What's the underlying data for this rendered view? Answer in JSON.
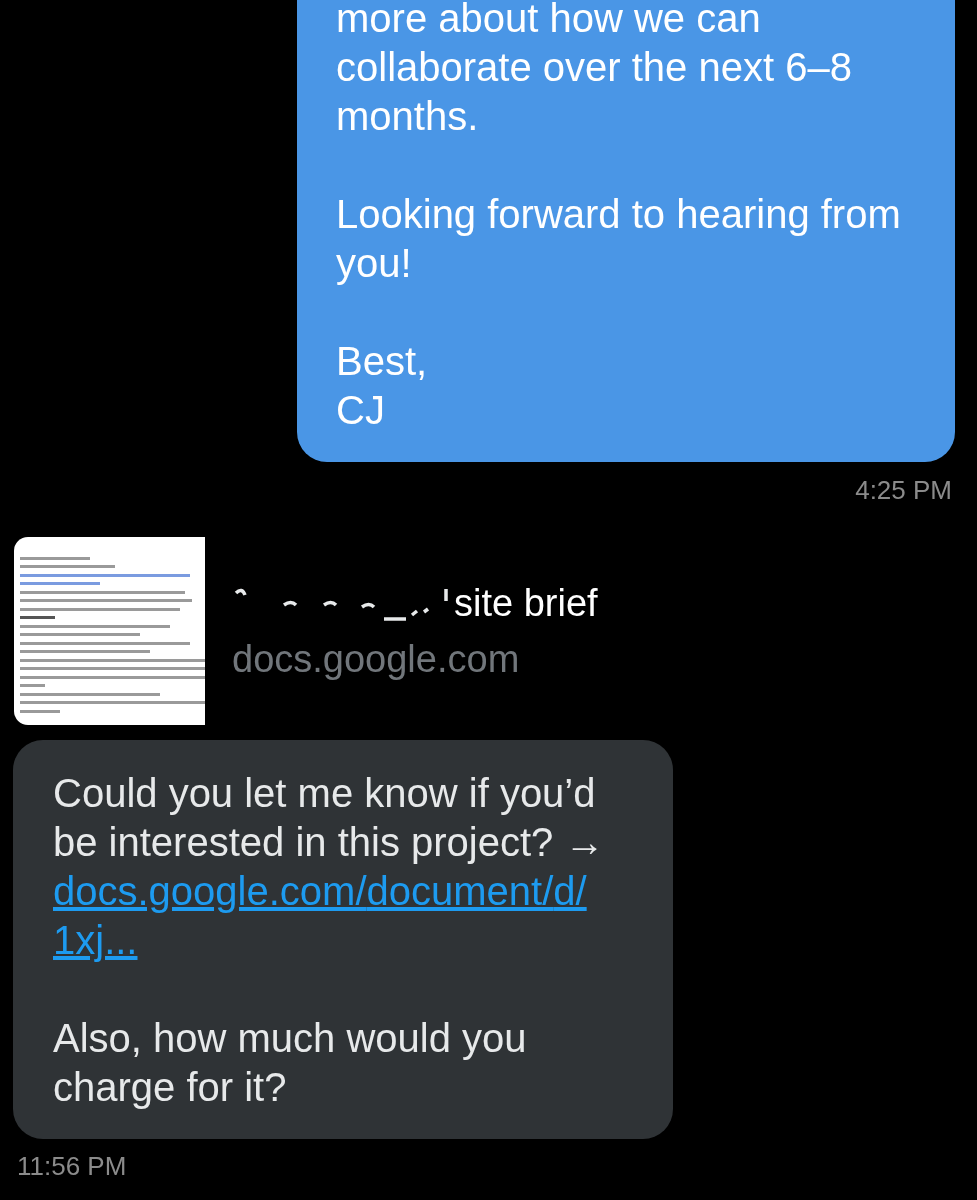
{
  "messages": [
    {
      "kind": "sent",
      "paragraphs": [
        "more about how we can collaborate over the next 6–8 months.",
        "Looking forward to hearing from you!",
        "Best,\nCJ"
      ],
      "time": "4:25 PM"
    },
    {
      "kind": "link_preview",
      "title": "site brief",
      "domain": "docs.google.com",
      "redacted": true
    },
    {
      "kind": "received",
      "text": "Could you let me know if you’d be interested in this project? →",
      "link": "docs.google.com/document/d/1xj...",
      "paragraphs": [
        "Also, how much would you charge for it?"
      ],
      "time": "11:56 PM"
    }
  ]
}
